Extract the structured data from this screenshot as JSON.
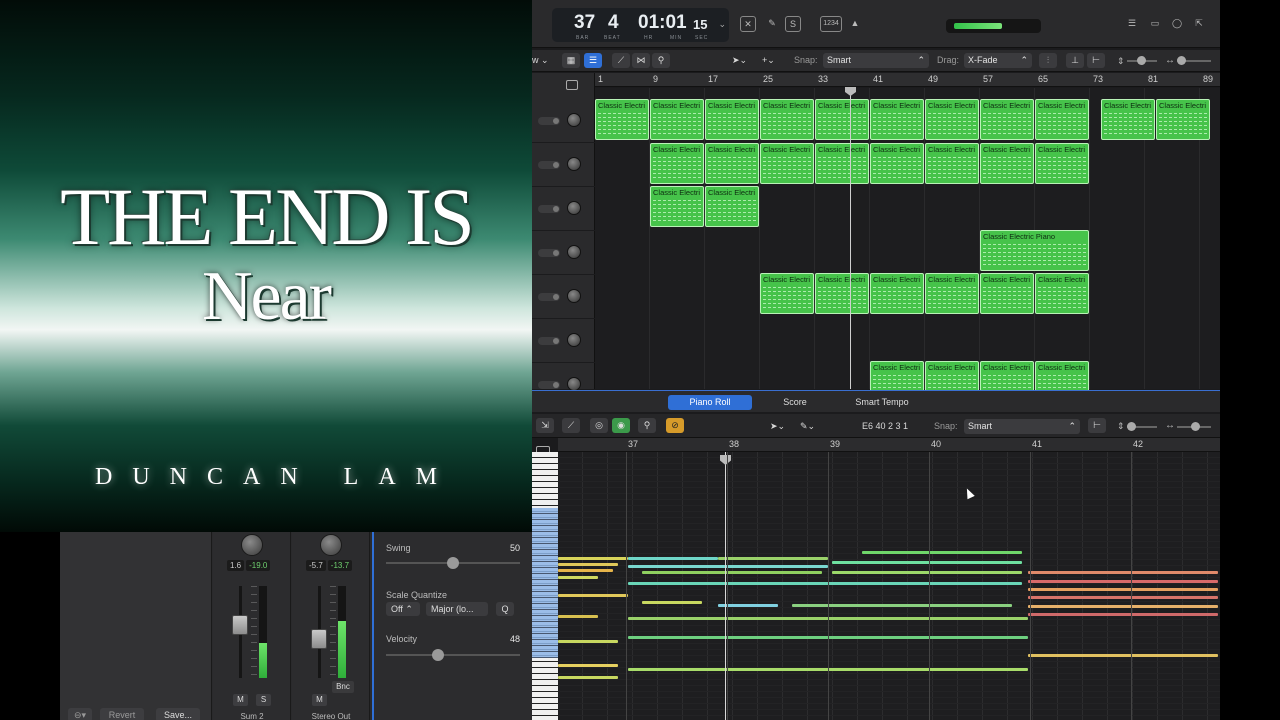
{
  "album": {
    "title_line1": "THE END IS",
    "title_line2": "Near",
    "artist": "DUNCAN LAM"
  },
  "mixer": {
    "bottom": {
      "revert_label": "Revert",
      "save_label": "Save..."
    },
    "strips": [
      {
        "name": "Sum 2",
        "pan": "1.6",
        "level": "-19.0",
        "mute": "M",
        "solo": "S",
        "meter": 0.38,
        "fader": 0.6
      },
      {
        "name": "Stereo Out",
        "pan": "-5.7",
        "level": "-13.7",
        "mute": "M",
        "bounce": "Bnc",
        "meter": 0.62,
        "fader": 0.4
      }
    ],
    "params": {
      "swing_label": "Swing",
      "swing_value": "50",
      "swing": 0.5,
      "scale_label": "Scale Quantize",
      "scale_off": "Off",
      "scale_mode": "Major (lo...",
      "q_label": "Q",
      "velocity_label": "Velocity",
      "velocity_value": "48",
      "velocity": 0.38
    }
  },
  "control_bar": {
    "bar": "37",
    "beat": "4",
    "time": "01:01",
    "frames": "15",
    "labels": {
      "bar": "BAR",
      "beat": "BEAT",
      "hr": "HR",
      "min": "MIN",
      "sec": "SEC"
    },
    "count_in": "1234"
  },
  "tracks_toolbar": {
    "edit_menu": "w",
    "snap_label": "Snap:",
    "snap_value": "Smart",
    "drag_label": "Drag:",
    "drag_value": "X-Fade"
  },
  "ruler_bars": [
    "1",
    "9",
    "17",
    "25",
    "33",
    "41",
    "49",
    "57",
    "65",
    "73",
    "81",
    "89"
  ],
  "region_name": "Classic Electri",
  "region_full_name": "Classic Electric Piano",
  "piano_roll": {
    "tabs": [
      "Piano Roll",
      "Score",
      "Smart Tempo"
    ],
    "note_info": "E6  40 2 3 1",
    "snap_label": "Snap:",
    "snap_value": "Smart",
    "bars": [
      "37",
      "38",
      "39",
      "40",
      "41",
      "42"
    ]
  },
  "colors": {
    "region": "#46c34a",
    "accent": "#2f6fd6"
  }
}
